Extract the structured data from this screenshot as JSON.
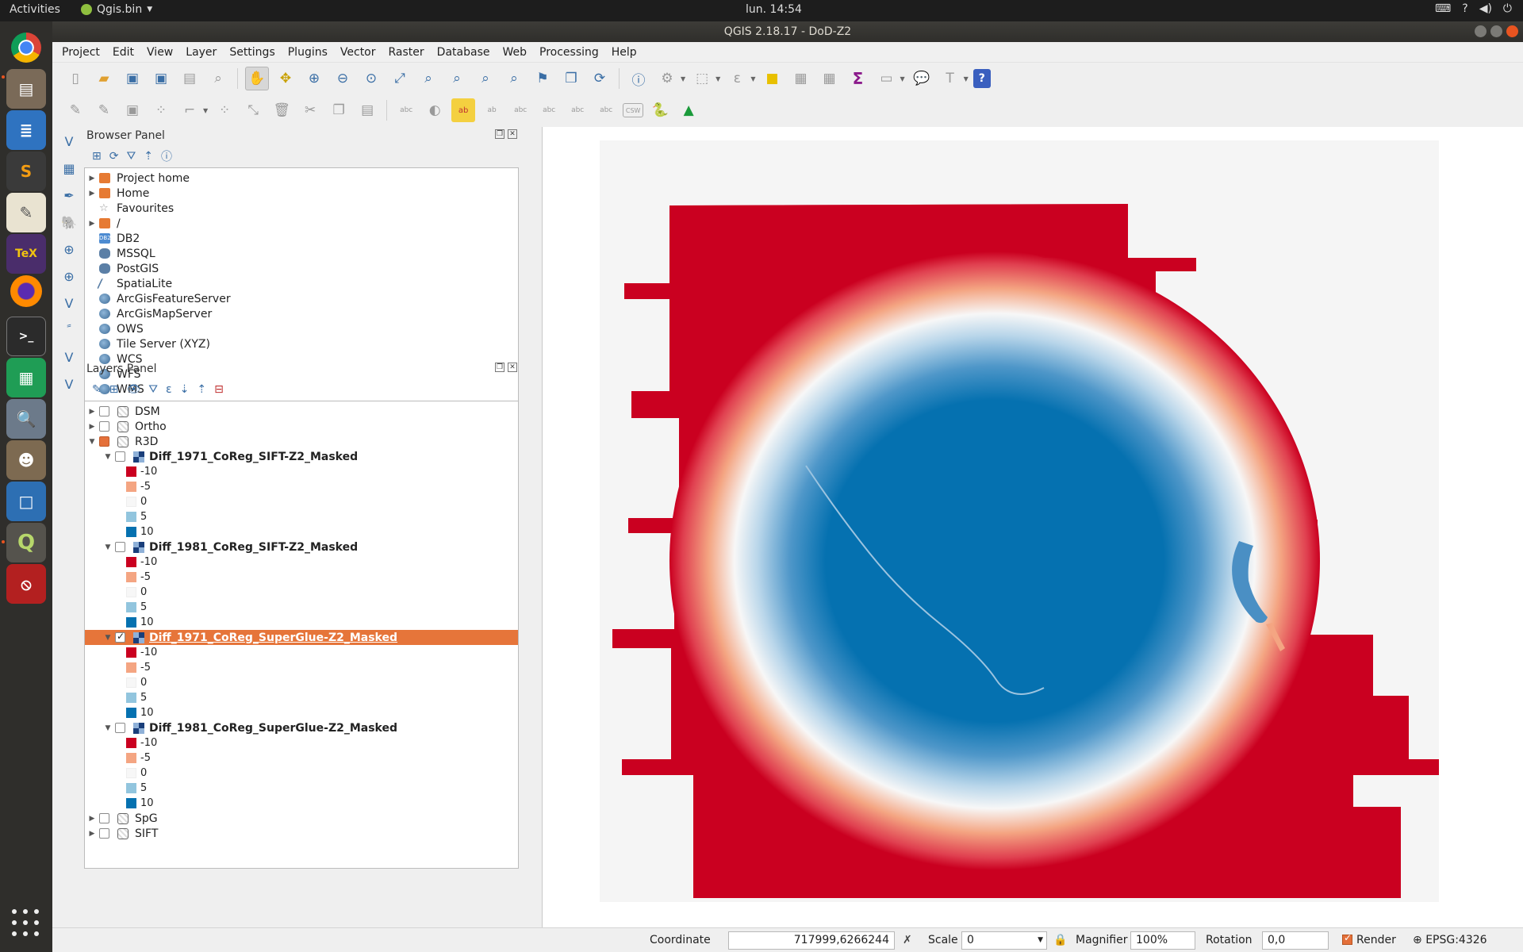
{
  "topbar": {
    "activities": "Activities",
    "app_name": "Qgis.bin",
    "clock": "lun. 14:54",
    "tray_icons": [
      "keyboard-icon",
      "accessibility-icon",
      "volume-icon",
      "power-icon"
    ]
  },
  "dock": {
    "items": [
      "chrome-icon",
      "files-icon",
      "writer-icon",
      "sublime-icon",
      "text-editor-icon",
      "texmaker-icon",
      "firefox-icon",
      "terminal-icon",
      "calc-icon",
      "image-viewer-icon",
      "gimp-icon",
      "virtualbox-icon",
      "qgis-icon",
      "blocked-icon"
    ]
  },
  "window": {
    "title": "QGIS 2.18.17 - DoD-Z2"
  },
  "menu": [
    "Project",
    "Edit",
    "View",
    "Layer",
    "Settings",
    "Plugins",
    "Vector",
    "Raster",
    "Database",
    "Web",
    "Processing",
    "Help"
  ],
  "browser_panel": {
    "title": "Browser Panel",
    "items": [
      {
        "label": "Project home",
        "icon": "folder-icon",
        "expandable": true
      },
      {
        "label": "Home",
        "icon": "folder-icon",
        "expandable": true
      },
      {
        "label": "Favourites",
        "icon": "star-icon",
        "expandable": false
      },
      {
        "label": "/",
        "icon": "folder-icon",
        "expandable": true
      },
      {
        "label": "DB2",
        "icon": "db2-icon",
        "expandable": false
      },
      {
        "label": "MSSQL",
        "icon": "mssql-icon",
        "expandable": false
      },
      {
        "label": "PostGIS",
        "icon": "postgis-icon",
        "expandable": false
      },
      {
        "label": "SpatiaLite",
        "icon": "spatialite-icon",
        "expandable": false
      },
      {
        "label": "ArcGisFeatureServer",
        "icon": "arcgis-icon",
        "expandable": false
      },
      {
        "label": "ArcGisMapServer",
        "icon": "arcgis-icon",
        "expandable": false
      },
      {
        "label": "OWS",
        "icon": "globe-icon",
        "expandable": false
      },
      {
        "label": "Tile Server (XYZ)",
        "icon": "globe-icon",
        "expandable": false
      },
      {
        "label": "WCS",
        "icon": "globe-icon",
        "expandable": false
      },
      {
        "label": "WFS",
        "icon": "globe-icon",
        "expandable": false
      },
      {
        "label": "WMS",
        "icon": "globe-icon",
        "expandable": false
      }
    ]
  },
  "layers_panel": {
    "title": "Layers Panel",
    "groups_top": [
      {
        "label": "DSM",
        "checked": false
      },
      {
        "label": "Ortho",
        "checked": false
      }
    ],
    "r3d": {
      "label": "R3D"
    },
    "legend": [
      {
        "value": "-10",
        "color": "#ca0020"
      },
      {
        "value": "-5",
        "color": "#f4a582"
      },
      {
        "value": "0",
        "color": "#f7f7f7"
      },
      {
        "value": "5",
        "color": "#92c5de"
      },
      {
        "value": "10",
        "color": "#0571b0"
      }
    ],
    "rasters": [
      {
        "label": "Diff_1971_CoReg_SIFT-Z2_Masked",
        "checked": false,
        "selected": false
      },
      {
        "label": "Diff_1981_CoReg_SIFT-Z2_Masked",
        "checked": false,
        "selected": false
      },
      {
        "label": "Diff_1971_CoReg_SuperGlue-Z2_Masked",
        "checked": true,
        "selected": true
      },
      {
        "label": "Diff_1981_CoReg_SuperGlue-Z2_Masked",
        "checked": false,
        "selected": false
      }
    ],
    "groups_bottom": [
      {
        "label": "SpG",
        "checked": false
      },
      {
        "label": "SIFT",
        "checked": false
      }
    ]
  },
  "statusbar": {
    "coordinate_label": "Coordinate",
    "coordinate_value": "717999,6266244",
    "scale_label": "Scale",
    "scale_value": "0",
    "magnifier_label": "Magnifier",
    "magnifier_value": "100%",
    "rotation_label": "Rotation",
    "rotation_value": "0,0",
    "render_label": "Render",
    "crs": "EPSG:4326"
  },
  "colors": {
    "accent": "#e4703a",
    "ramp_low": "#ca0020",
    "ramp_high": "#0571b0"
  }
}
